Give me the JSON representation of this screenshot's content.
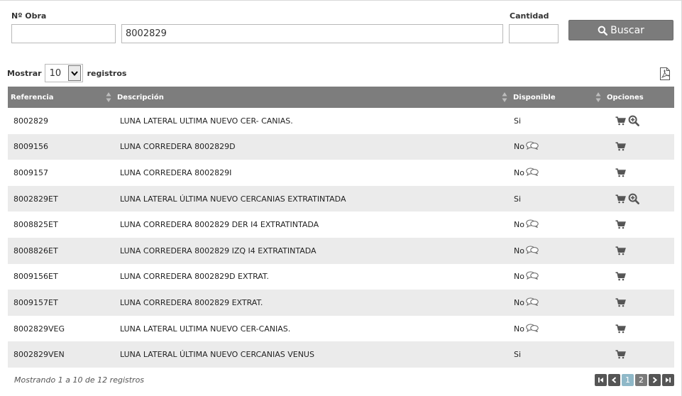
{
  "form": {
    "obra_label": "Nº Obra",
    "obra_value": "",
    "referencia_value": "8002829",
    "cantidad_label": "Cantidad",
    "cantidad_value": "",
    "buscar_label": "Buscar"
  },
  "length": {
    "mostrar": "Mostrar",
    "value": "10",
    "registros": "registros"
  },
  "table": {
    "headers": {
      "referencia": "Referencia",
      "descripcion": "Descripción",
      "disponible": "Disponible",
      "opciones": "Opciones"
    },
    "rows": [
      {
        "ref": "8002829",
        "desc": "LUNA LATERAL ULTIMA NUEVO CER- CANIAS.",
        "disp": "Si",
        "chat": false,
        "zoom": true
      },
      {
        "ref": "8009156",
        "desc": "LUNA CORREDERA 8002829D",
        "disp": "No",
        "chat": true,
        "zoom": false
      },
      {
        "ref": "8009157",
        "desc": "LUNA CORREDERA 8002829I",
        "disp": "No",
        "chat": true,
        "zoom": false
      },
      {
        "ref": "8002829ET",
        "desc": "LUNA LATERAL ÚLTIMA NUEVO CERCANIAS EXTRATINTADA",
        "disp": "Si",
        "chat": false,
        "zoom": true
      },
      {
        "ref": "8008825ET",
        "desc": "LUNA CORREDERA 8002829 DER I4 EXTRATINTADA",
        "disp": "No",
        "chat": true,
        "zoom": false
      },
      {
        "ref": "8008826ET",
        "desc": "LUNA CORREDERA 8002829 IZQ I4 EXTRATINTADA",
        "disp": "No",
        "chat": true,
        "zoom": false
      },
      {
        "ref": "8009156ET",
        "desc": "LUNA CORREDERA 8002829D EXTRAT.",
        "disp": "No",
        "chat": true,
        "zoom": false
      },
      {
        "ref": "8009157ET",
        "desc": "LUNA CORREDERA 8002829 EXTRAT.",
        "disp": "No",
        "chat": true,
        "zoom": false
      },
      {
        "ref": "8002829VEG",
        "desc": "LUNA LATERAL ULTIMA NUEVO CER-CANIAS.",
        "disp": "No",
        "chat": true,
        "zoom": false
      },
      {
        "ref": "8002829VEN",
        "desc": "LUNA LATERAL ÚLTIMA NUEVO CERCANIAS VENUS",
        "disp": "Si",
        "chat": false,
        "zoom": false
      }
    ]
  },
  "footer": {
    "info": "Mostrando 1 a 10 de 12 registros",
    "pages": [
      "1",
      "2"
    ],
    "active_page": "1"
  },
  "colors": {
    "header_bg": "#7d7d7d",
    "button_bg": "#7b7b7b",
    "row_alt": "#ebebeb",
    "active_page": "#8fb8c8"
  },
  "icons": [
    "search-icon",
    "pdf-icon",
    "sort-icon",
    "cart-icon",
    "zoom-in-icon",
    "chat-bubbles-icon",
    "first-page-icon",
    "prev-page-icon",
    "next-page-icon",
    "last-page-icon"
  ]
}
